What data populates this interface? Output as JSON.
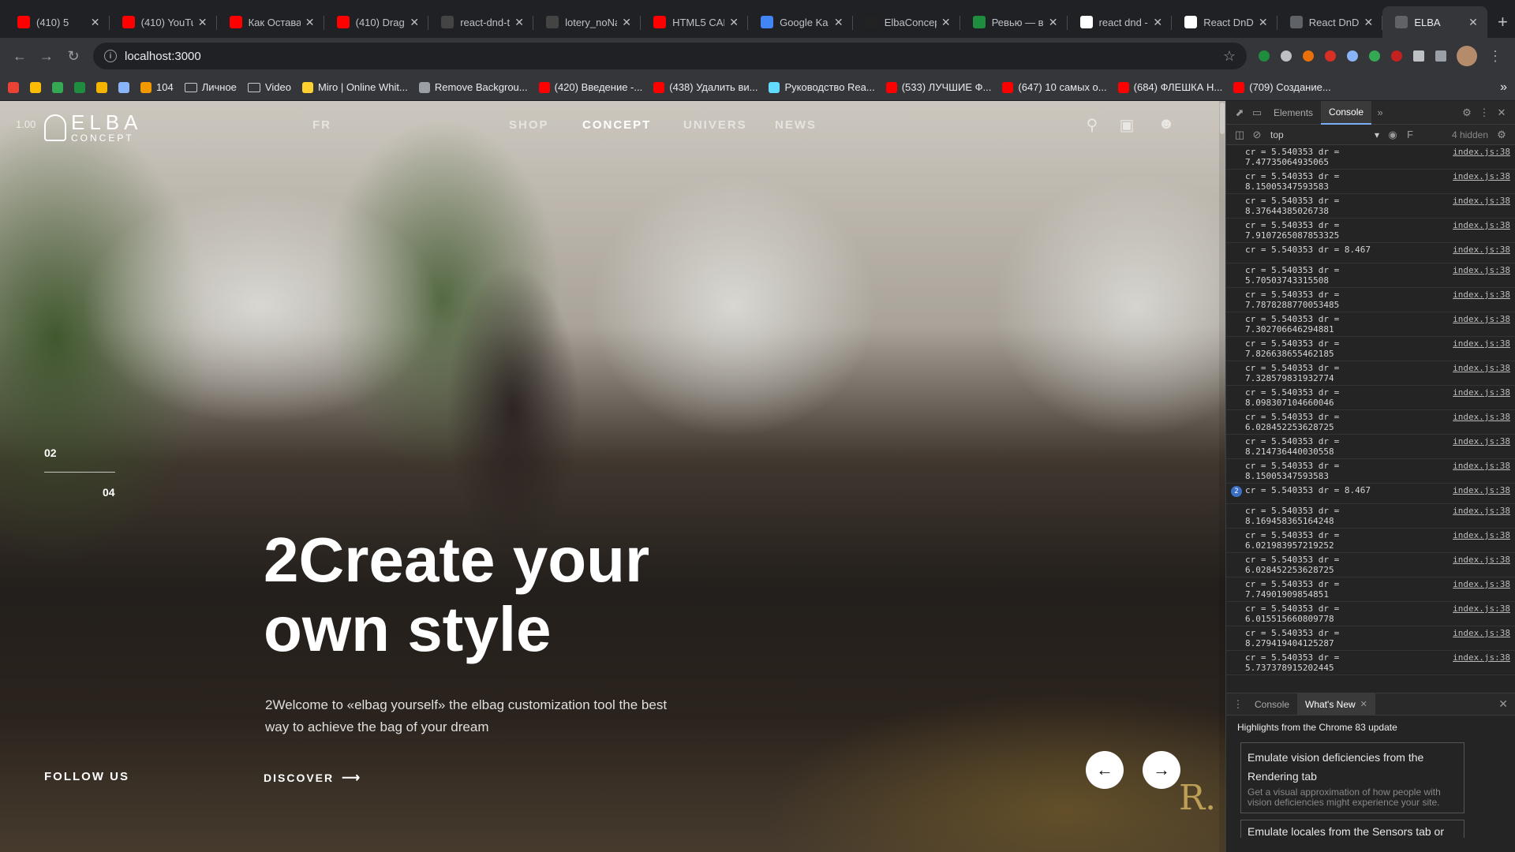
{
  "browser": {
    "tabs": [
      {
        "title": "(410) 5",
        "color": "#ff0000"
      },
      {
        "title": "(410) YouTu",
        "color": "#ff0000"
      },
      {
        "title": "Как Остава",
        "color": "#ff0000"
      },
      {
        "title": "(410) Drag",
        "color": "#ff0000"
      },
      {
        "title": "react-dnd-t",
        "color": "#444444"
      },
      {
        "title": "lotery_noNa",
        "color": "#444444"
      },
      {
        "title": "HTML5 CAN",
        "color": "#ff0000"
      },
      {
        "title": "Google Ka",
        "color": "#4285f4"
      },
      {
        "title": "ElbaConcep",
        "color": "#222222"
      },
      {
        "title": "Ревью — в",
        "color": "#1e8e3e"
      },
      {
        "title": "react dnd -",
        "color": "#ffffff"
      },
      {
        "title": "React DnD",
        "color": "#ffffff"
      },
      {
        "title": "React DnD",
        "color": "#5f6368"
      },
      {
        "title": "ELBA",
        "color": "#5f6368",
        "active": true
      }
    ],
    "url": "localhost:3000",
    "bookmarks": [
      {
        "label": "",
        "color": "#ea4335"
      },
      {
        "label": "",
        "color": "#fbbc04"
      },
      {
        "label": "",
        "color": "#34a853"
      },
      {
        "label": "",
        "color": "#1e8e3e"
      },
      {
        "label": "",
        "color": "#f4b400"
      },
      {
        "label": "",
        "color": "#8ab4f8"
      },
      {
        "label": "104",
        "color": "#f29900"
      },
      {
        "label": "Личное",
        "folder": true
      },
      {
        "label": "Video",
        "folder": true
      },
      {
        "label": "Miro | Online Whit...",
        "color": "#ffd02f"
      },
      {
        "label": "Remove Backgrou...",
        "color": "#9aa0a6"
      },
      {
        "label": "(420) Введение -...",
        "color": "#ff0000"
      },
      {
        "label": "(438) Удалить ви...",
        "color": "#ff0000"
      },
      {
        "label": "Руководство Rea...",
        "color": "#61dafb"
      },
      {
        "label": "(533) ЛУЧШИЕ Ф...",
        "color": "#ff0000"
      },
      {
        "label": "(647) 10 самых о...",
        "color": "#ff0000"
      },
      {
        "label": "(684) ФЛЕШКА Н...",
        "color": "#ff0000"
      },
      {
        "label": "(709) Создание...",
        "color": "#ff0000"
      }
    ],
    "bookmarks_more": "»"
  },
  "site": {
    "version": "1.00",
    "logo_main": "ELBA",
    "logo_sub": "CONCEPT",
    "lang": "FR",
    "nav": {
      "shop": "SHOP",
      "concept": "CONCEPT",
      "universe": "UNIVERS",
      "news": "NEWS"
    },
    "slide_current": "02",
    "slide_total": "04",
    "headline": "2Create your own style",
    "subtext": "2Welcome to «elbag yourself» the elbag customization tool the best way to achieve the bag of your dream",
    "follow_us": "FOLLOW US",
    "discover": "DISCOVER",
    "watermark": "R."
  },
  "devtools": {
    "tabs": {
      "elements": "Elements",
      "console": "Console"
    },
    "context": "top",
    "hidden": "4 hidden",
    "filter_placeholder": "F",
    "logs": [
      {
        "msg": "cr = 5.540353 dr =\n7.47735064935065",
        "src": "index.js:38"
      },
      {
        "msg": "cr = 5.540353 dr =\n8.15005347593583",
        "src": "index.js:38"
      },
      {
        "msg": "cr = 5.540353 dr =\n8.37644385026738",
        "src": "index.js:38"
      },
      {
        "msg": "cr = 5.540353 dr =\n7.9107265087853325",
        "src": "index.js:38"
      },
      {
        "msg": "cr = 5.540353 dr = 8.467",
        "src": "index.js:38"
      },
      {
        "msg": "cr = 5.540353 dr =\n5.70503743315508",
        "src": "index.js:38"
      },
      {
        "msg": "cr = 5.540353 dr =\n7.7878288770053485",
        "src": "index.js:38"
      },
      {
        "msg": "cr = 5.540353 dr =\n7.302706646294881",
        "src": "index.js:38"
      },
      {
        "msg": "cr = 5.540353 dr =\n7.826638655462185",
        "src": "index.js:38"
      },
      {
        "msg": "cr = 5.540353 dr =\n7.328579831932774",
        "src": "index.js:38"
      },
      {
        "msg": "cr = 5.540353 dr =\n8.098307104660046",
        "src": "index.js:38"
      },
      {
        "msg": "cr = 5.540353 dr =\n6.028452253628725",
        "src": "index.js:38"
      },
      {
        "msg": "cr = 5.540353 dr =\n8.214736440030558",
        "src": "index.js:38"
      },
      {
        "msg": "cr = 5.540353 dr =\n8.15005347593583",
        "src": "index.js:38"
      },
      {
        "msg": "cr = 5.540353 dr = 8.467",
        "src": "index.js:38",
        "count": "2"
      },
      {
        "msg": "cr = 5.540353 dr =\n8.169458365164248",
        "src": "index.js:38"
      },
      {
        "msg": "cr = 5.540353 dr =\n6.021983957219252",
        "src": "index.js:38"
      },
      {
        "msg": "cr = 5.540353 dr =\n6.028452253628725",
        "src": "index.js:38"
      },
      {
        "msg": "cr = 5.540353 dr =\n7.74901909854851",
        "src": "index.js:38"
      },
      {
        "msg": "cr = 5.540353 dr =\n6.015515660809778",
        "src": "index.js:38"
      },
      {
        "msg": "cr = 5.540353 dr =\n8.279419404125287",
        "src": "index.js:38"
      },
      {
        "msg": "cr = 5.540353 dr =\n5.737378915202445",
        "src": "index.js:38"
      }
    ],
    "drawer": {
      "console_tab": "Console",
      "whatsnew_tab": "What's New",
      "highlights": "Highlights from the Chrome 83 update",
      "card1_title": "Emulate vision deficiencies from the Rendering tab",
      "card1_desc": "Get a visual approximation of how people with vision deficiencies might experience your site.",
      "card2_title": "Emulate locales from the Sensors tab or"
    }
  }
}
